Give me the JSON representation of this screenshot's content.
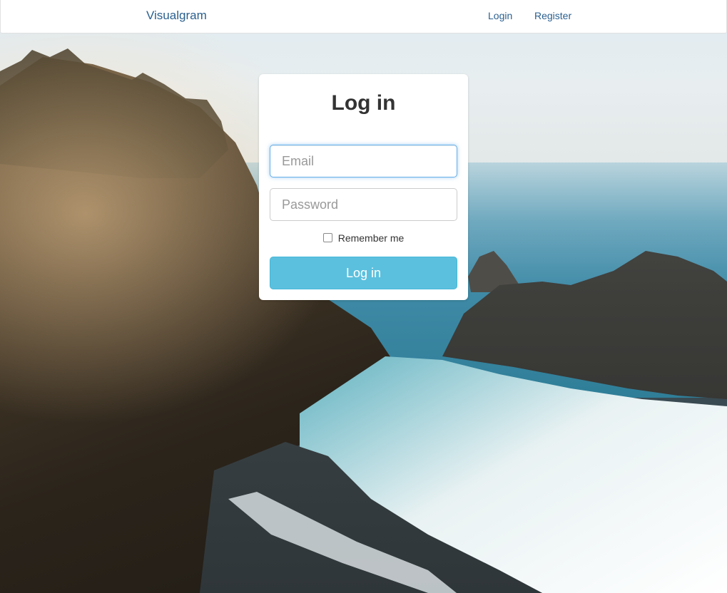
{
  "navbar": {
    "brand": "Visualgram",
    "links": [
      {
        "label": "Login"
      },
      {
        "label": "Register"
      }
    ]
  },
  "login_form": {
    "title": "Log in",
    "email": {
      "value": "",
      "placeholder": "Email"
    },
    "password": {
      "value": "",
      "placeholder": "Password"
    },
    "remember_label": "Remember me",
    "remember_checked": false,
    "submit_label": "Log in"
  },
  "colors": {
    "link": "#2a5f8f",
    "button": "#5bc0de",
    "focus_border": "#66afe9"
  }
}
